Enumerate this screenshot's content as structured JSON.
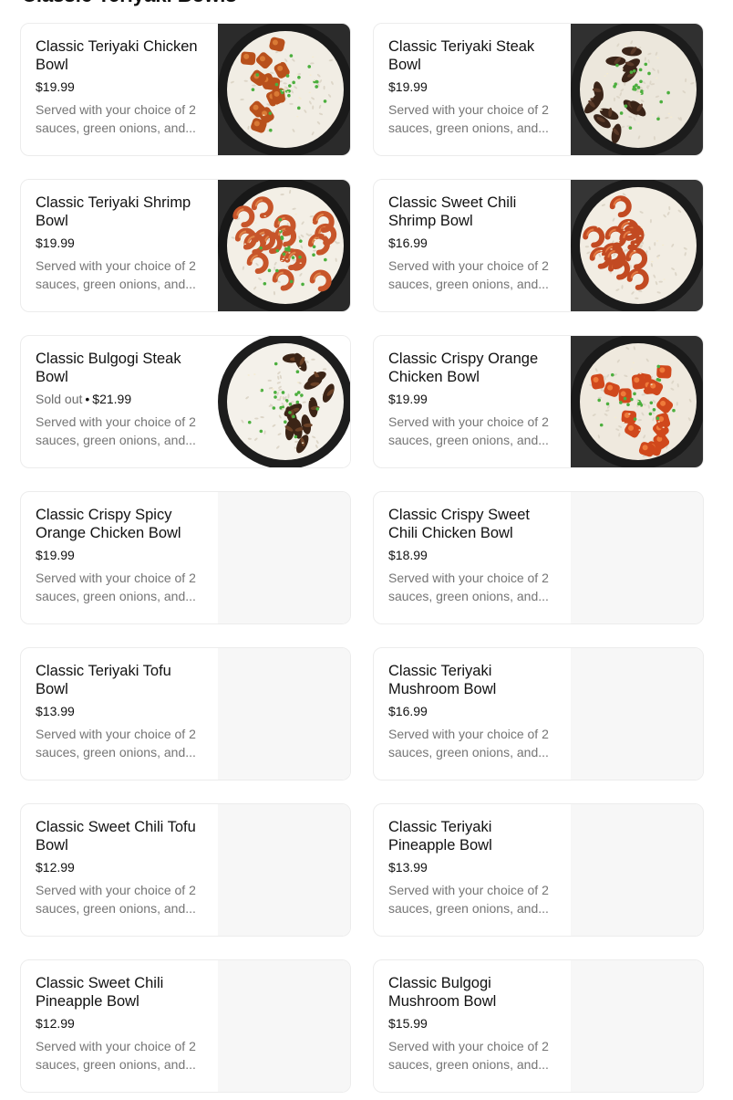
{
  "section": {
    "title": "Classic Teriyaki Bowls"
  },
  "items": [
    {
      "name": "Classic Teriyaki Chicken Bowl",
      "price": "$19.99",
      "sold_out_label": "",
      "desc_line1": "Served with your choice of 2",
      "desc_line2": "sauces, green onions, and...",
      "image": "teriyaki-chicken"
    },
    {
      "name": "Classic Teriyaki Steak Bowl",
      "price": "$19.99",
      "sold_out_label": "",
      "desc_line1": "Served with your choice of 2",
      "desc_line2": "sauces, green onions, and...",
      "image": "teriyaki-steak"
    },
    {
      "name": "Classic Teriyaki Shrimp Bowl",
      "price": "$19.99",
      "sold_out_label": "",
      "desc_line1": "Served with your choice of 2",
      "desc_line2": "sauces, green onions, and...",
      "image": "teriyaki-shrimp"
    },
    {
      "name": "Classic Sweet Chili Shrimp Bowl",
      "price": "$16.99",
      "sold_out_label": "",
      "desc_line1": "Served with your choice of 2",
      "desc_line2": "sauces, green onions, and...",
      "image": "sweet-chili-shrimp"
    },
    {
      "name": "Classic Bulgogi Steak Bowl",
      "price": "$21.99",
      "sold_out_label": "Sold out",
      "desc_line1": "Served with your choice of 2",
      "desc_line2": "sauces, green onions, and...",
      "image": "bulgogi-steak"
    },
    {
      "name": "Classic Crispy Orange Chicken Bowl",
      "price": "$19.99",
      "sold_out_label": "",
      "desc_line1": "Served with your choice of 2",
      "desc_line2": "sauces, green onions, and...",
      "image": "crispy-orange-chicken"
    },
    {
      "name": "Classic Crispy Spicy Orange Chicken Bowl",
      "price": "$19.99",
      "sold_out_label": "",
      "desc_line1": "Served with your choice of 2",
      "desc_line2": "sauces, green onions, and...",
      "image": ""
    },
    {
      "name": "Classic Crispy Sweet Chili Chicken Bowl",
      "price": "$18.99",
      "sold_out_label": "",
      "desc_line1": "Served with your choice of 2",
      "desc_line2": "sauces, green onions, and...",
      "image": ""
    },
    {
      "name": "Classic Teriyaki Tofu Bowl",
      "price": "$13.99",
      "sold_out_label": "",
      "desc_line1": "Served with your choice of 2",
      "desc_line2": "sauces, green onions, and...",
      "image": ""
    },
    {
      "name": "Classic Teriyaki Mushroom Bowl",
      "price": "$16.99",
      "sold_out_label": "",
      "desc_line1": "Served with your choice of 2",
      "desc_line2": "sauces, green onions, and...",
      "image": ""
    },
    {
      "name": "Classic Sweet Chili Tofu Bowl",
      "price": "$12.99",
      "sold_out_label": "",
      "desc_line1": "Served with your choice of 2",
      "desc_line2": "sauces, green onions, and...",
      "image": ""
    },
    {
      "name": "Classic Teriyaki Pineapple Bowl",
      "price": "$13.99",
      "sold_out_label": "",
      "desc_line1": "Served with your choice of 2",
      "desc_line2": "sauces, green onions, and...",
      "image": ""
    },
    {
      "name": "Classic Sweet Chili Pineapple  Bowl",
      "price": "$12.99",
      "sold_out_label": "",
      "desc_line1": "Served with your choice of 2",
      "desc_line2": "sauces, green onions, and...",
      "image": ""
    },
    {
      "name": "Classic Bulgogi Mushroom Bowl",
      "price": "$15.99",
      "sold_out_label": "",
      "desc_line1": "Served with your choice of 2",
      "desc_line2": "sauces, green onions, and...",
      "image": ""
    }
  ],
  "separator": "•",
  "colors": {
    "card_border": "#ececec",
    "placeholder_bg": "#f7f7f7",
    "description_text": "#757575",
    "sold_out_text": "#6b6b6b"
  }
}
